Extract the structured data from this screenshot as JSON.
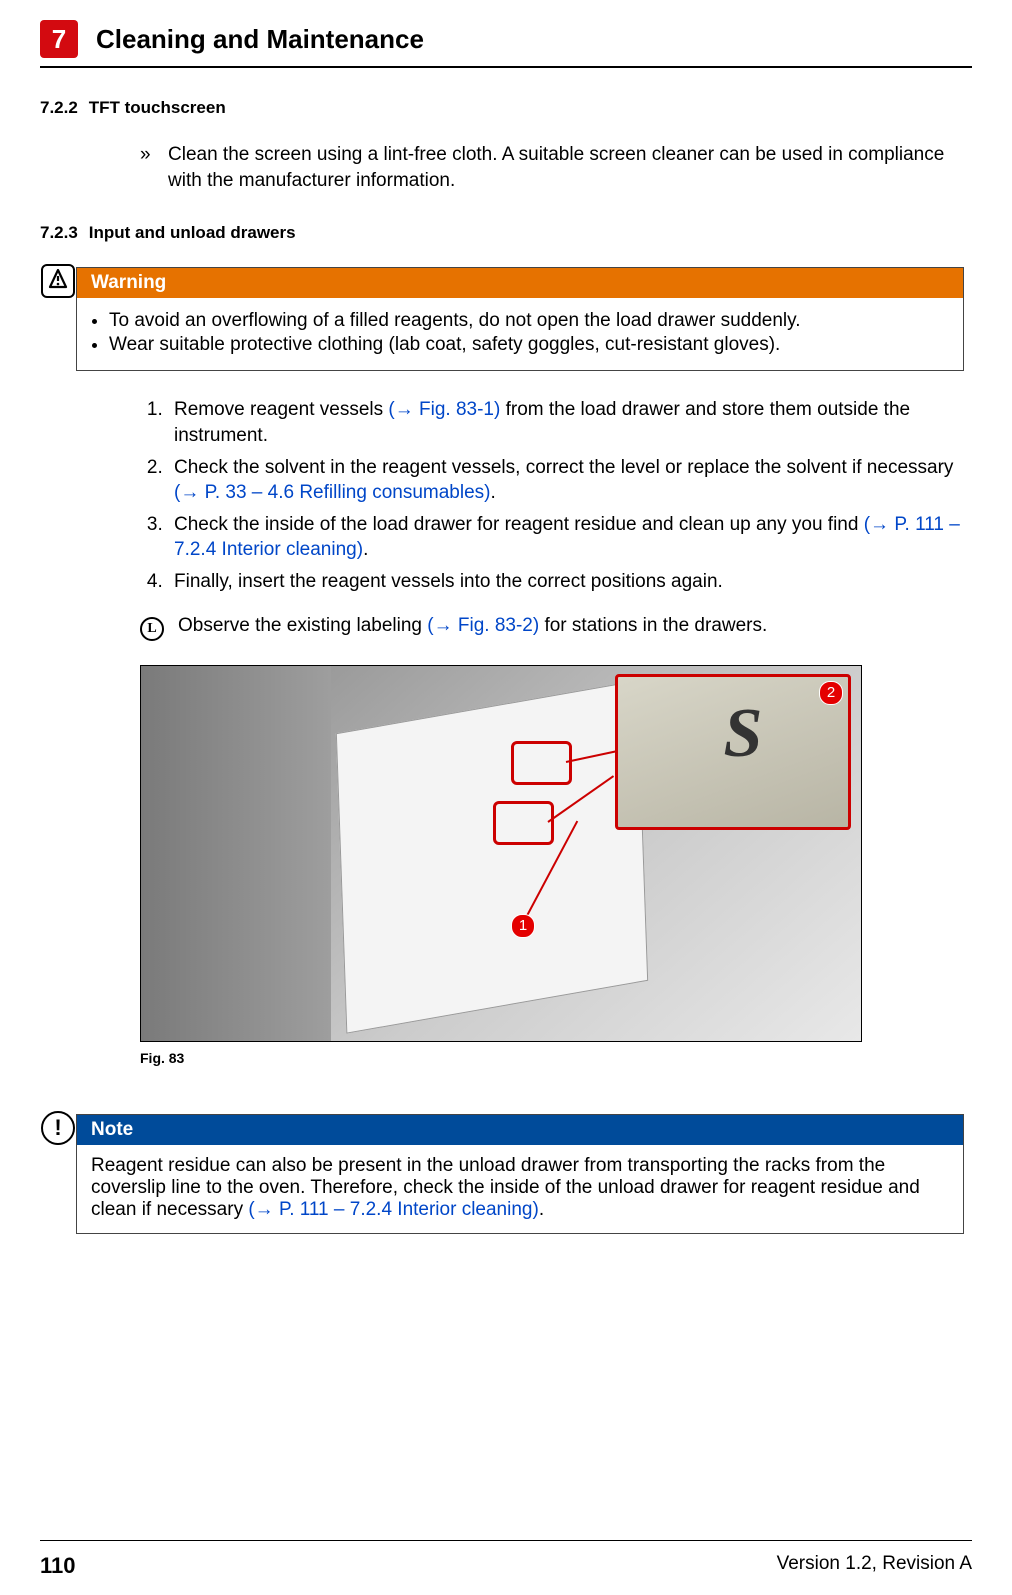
{
  "header": {
    "chapter_number": "7",
    "chapter_title": "Cleaning and Maintenance"
  },
  "section_722": {
    "number": "7.2.2",
    "title": "TFT touchscreen",
    "item1": "Clean the screen using a lint-free cloth. A suitable screen cleaner can be used in compliance with the manufacturer information."
  },
  "section_723": {
    "number": "7.2.3",
    "title": "Input and unload drawers"
  },
  "warning": {
    "label": "Warning",
    "bullet1": "To avoid an overflowing of a filled reagents, do not open the load drawer suddenly.",
    "bullet2": "Wear suitable protective clothing (lab coat, safety goggles, cut-resistant gloves)."
  },
  "steps": {
    "s1a": "Remove reagent vessels ",
    "s1_ref": "(→ Fig.  83-1)",
    "s1b": " from the load drawer and store them outside the instrument.",
    "s2a": "Check the solvent in the reagent vessels, correct the level or replace the solvent if necessary ",
    "s2_ref": "(→ P. 33 – 4.6 Refilling consumables)",
    "s2b": ".",
    "s3a": "Check the inside of the load drawer for reagent residue and clean up any you find ",
    "s3_ref": "(→ P. 111 – 7.2.4 Interior cleaning)",
    "s3b": ".",
    "s4": "Finally, insert the reagent vessels into the correct positions again."
  },
  "info_line": {
    "a": "Observe the existing labeling ",
    "ref": "(→ Fig.  83-2)",
    "b": " for stations in the drawers."
  },
  "figure": {
    "caption": "Fig.  83",
    "callout1": "1",
    "callout2": "2",
    "inset_label": "S"
  },
  "note": {
    "label": "Note",
    "body_a": "Reagent residue can also be present in the unload drawer from transporting the racks from the coverslip line to the oven. Therefore, check the inside of the unload drawer for reagent residue and clean if necessary ",
    "ref": "(→ P. 111 – 7.2.4 Interior cleaning)",
    "body_b": "."
  },
  "footer": {
    "page_number": "110",
    "version": "Version 1.2, Revision A"
  }
}
